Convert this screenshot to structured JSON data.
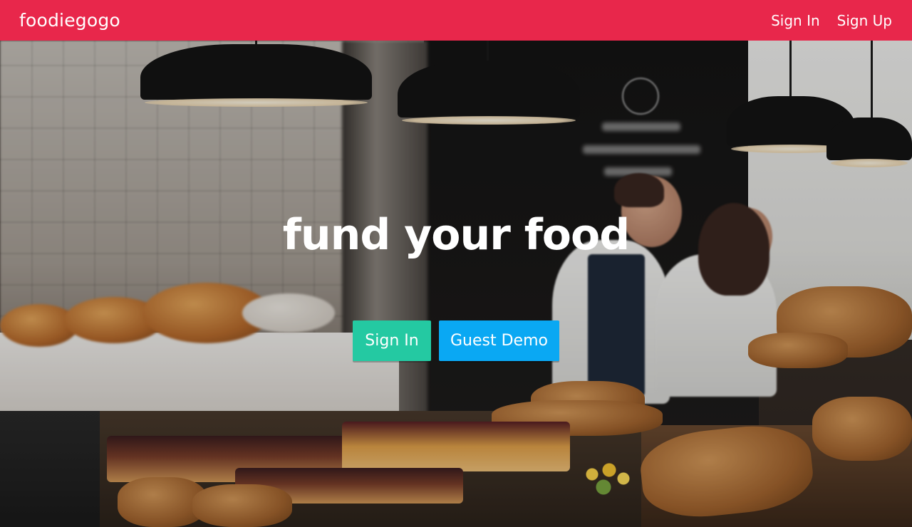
{
  "header": {
    "brand": "foodiegogo",
    "nav": {
      "sign_in": "Sign In",
      "sign_up": "Sign Up"
    },
    "color": "#e8274b"
  },
  "hero": {
    "title": "fund your food",
    "buttons": {
      "sign_in": "Sign In",
      "guest_demo": "Guest Demo"
    },
    "colors": {
      "sign_in": "#24c9a2",
      "guest_demo": "#0aa8f3"
    }
  }
}
